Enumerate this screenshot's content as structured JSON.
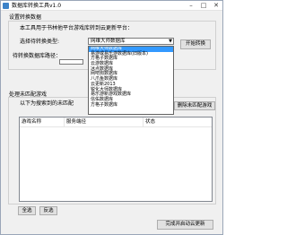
{
  "window": {
    "title": "数据库转换工具v1.0",
    "buttons": {
      "minimize": "–",
      "maximize": "□",
      "close": "✕"
    }
  },
  "settings": {
    "group_title": "设置转换数据",
    "intro": "本工具用于书林他平台游戏库转到云更新平台：",
    "source_type_label": "选择待转换类型:",
    "source_path_label": "待转换数据库路径：",
    "selected_type": "网维大师数据库",
    "start_button": "开始转换",
    "dropdown_options": [
      "网维大师数据库",
      "易游或易乐游数据库(旧版本)",
      "方格子数据库",
      "云游数据库",
      "冰点数据库",
      "网吧狗数据库",
      "八爪鱼数据库",
      "云更新2013",
      "锐化大师数据库",
      "易乐游新游戏数据库",
      "信佑数据库",
      "方格子数据库"
    ],
    "selected_index": 0
  },
  "mismatch": {
    "group_title": "处理未匹配游戏",
    "hint": "以下为搜索到的未匹配",
    "delete_button": "删除未匹配游戏",
    "columns": [
      "游戏名称",
      "服务端径",
      "状态"
    ]
  },
  "footer": {
    "select_all_button": "全选",
    "invert_button": "反选",
    "update_button": "完成并启动云更新"
  }
}
